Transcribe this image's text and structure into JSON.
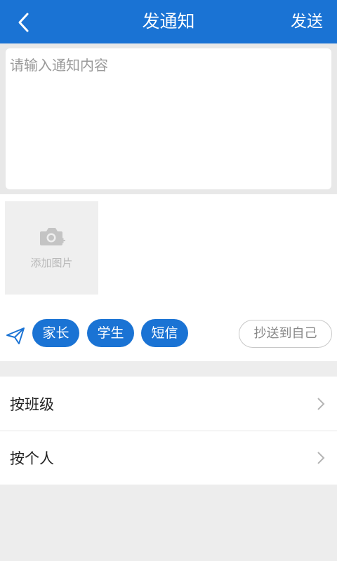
{
  "header": {
    "title": "发通知",
    "send_label": "发送"
  },
  "compose": {
    "placeholder": "请输入通知内容",
    "value": ""
  },
  "attachment": {
    "add_image_label": "添加图片"
  },
  "recipients": {
    "chips": [
      {
        "label": "家长",
        "selected": true
      },
      {
        "label": "学生",
        "selected": true
      },
      {
        "label": "短信",
        "selected": true
      }
    ],
    "cc_self_label": "抄送到自己"
  },
  "select_by": {
    "items": [
      {
        "label": "按班级"
      },
      {
        "label": "按个人"
      }
    ]
  },
  "colors": {
    "primary": "#1a73d4",
    "background": "#ededed"
  }
}
